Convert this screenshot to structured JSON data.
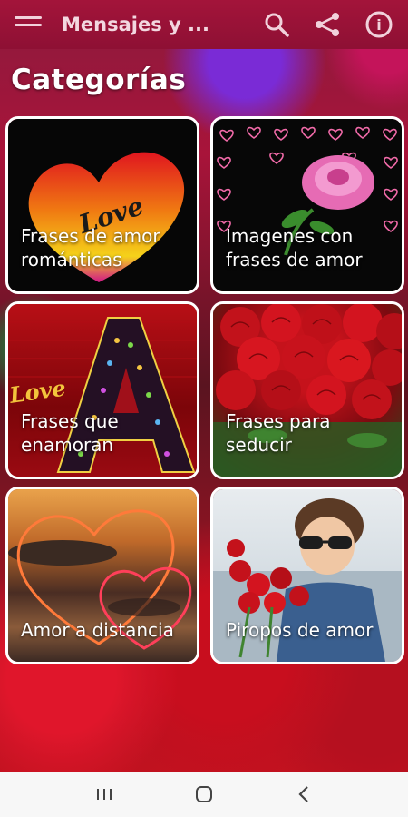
{
  "app": {
    "title": "Mensajes y ..."
  },
  "page": {
    "heading": "Categorías"
  },
  "categories": [
    {
      "label": "Frases de amor románticas"
    },
    {
      "label": "Imagenes con frases de amor"
    },
    {
      "label": "Frases que enamoran"
    },
    {
      "label": "Frases para seducir"
    },
    {
      "label": "Amor a distancia"
    },
    {
      "label": "Piropos de amor"
    }
  ],
  "art_text": {
    "love_word": "Love",
    "letter": "A"
  },
  "colors": {
    "toolbar": "#9e1238",
    "card_border": "#ffffff",
    "navbar": "#f7f7f7"
  },
  "icons": {
    "menu": "menu-icon",
    "search": "search-icon",
    "share": "share-icon",
    "info": "info-icon",
    "recents": "recents-icon",
    "home": "home-icon",
    "back": "back-icon"
  }
}
